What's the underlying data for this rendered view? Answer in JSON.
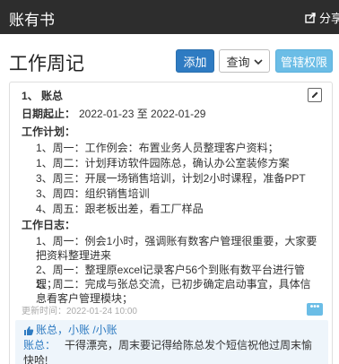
{
  "header": {
    "app_title": "账有书",
    "share_label": "分享",
    "share_icon": "share-icon"
  },
  "page": {
    "title": "工作周记"
  },
  "toolbar": {
    "add_label": "添加",
    "query_label": "查询",
    "permission_label": "管辖权限"
  },
  "journal": {
    "author": "1、 账总",
    "date_label": "日期起止：",
    "date_range": "2022-01-23 至 2022-01-29",
    "plan_heading": "工作计划：",
    "plan_items": [
      "1、周一：工作例会：布置业务人员整理客户资料；",
      "1、周二：计划拜访软件园陈总，确认办公室装修方案",
      "3、周三：开展一场销售培训，计划2小时课程，准备PPT",
      "3、周四：组织销售培训",
      "4、周五：跟老板出差，看工厂样品"
    ],
    "log_heading": "工作日志：",
    "log_items": [
      "1、周一：例会1小时，强调账有数客户管理很重要，大家要把资料整理进来",
      "2、周一：整理原excel记录客户56个到账有数平台进行管理；",
      "2、周二：完成与张总交流，已初步确定启动事宜，具体信息看客户管理模块；"
    ],
    "updated": "更新时间：2022-01-24 10:00",
    "more_label": "•••",
    "likes": "账总，小账 /小账",
    "comment_author": "账总：",
    "comment_text": "干得漂亮，周末要记得给陈总发个短信祝他过周末愉快哈!"
  }
}
